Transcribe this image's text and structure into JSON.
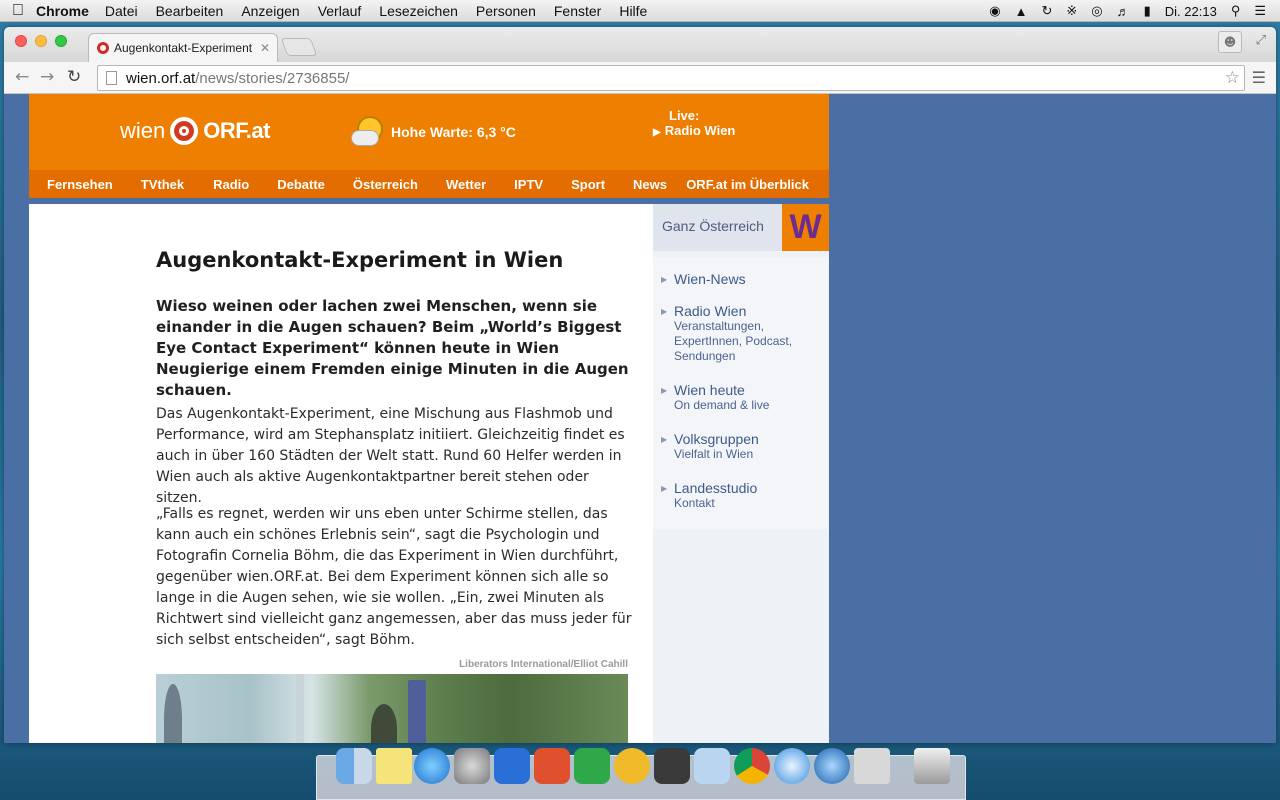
{
  "menubar": {
    "apple_icon": "apple-icon",
    "app_name": "Chrome",
    "items": [
      "Datei",
      "Bearbeiten",
      "Anzeigen",
      "Verlauf",
      "Lesezeichen",
      "Personen",
      "Fenster",
      "Hilfe"
    ],
    "clock": "Di. 22:13"
  },
  "browser": {
    "tab_title": "Augenkontakt-Experiment in Wien",
    "url_host": "wien.orf.at",
    "url_path": "/news/stories/2736855/"
  },
  "header": {
    "logo_left": "wien",
    "logo_right": "ORF.at",
    "weather": "Hohe Warte: 6,3 °C",
    "live_label": "Live:",
    "live_station": "Radio Wien"
  },
  "nav": {
    "items": [
      "Fernsehen",
      "TVthek",
      "Radio",
      "Debatte",
      "Österreich",
      "Wetter",
      "IPTV",
      "Sport",
      "News"
    ],
    "right": "ORF.at im Überblick"
  },
  "article": {
    "headline": "Augenkontakt-Experiment in Wien",
    "lead": "Wieso weinen oder lachen zwei Menschen, wenn sie einander in die Augen schauen? Beim „World’s Biggest Eye Contact Experiment“ können heute in Wien Neugierige einem Fremden einige Minuten in die Augen schauen.",
    "paragraph1": "Das Augenkontakt-Experiment, eine Mischung aus Flashmob und Performance, wird am Stephansplatz initiiert. Gleichzeitig findet es auch in über 160 Städten der Welt statt. Rund 60 Helfer werden in Wien auch als aktive Augenkontaktpartner bereit stehen oder sitzen.",
    "paragraph2": "„Falls es regnet, werden wir uns eben unter Schirme stellen, das kann auch ein schönes Erlebnis sein“, sagt die Psychologin und Fotografin Cornelia Böhm, die das Experiment in Wien durchführt, gegenüber wien.ORF.at. Bei dem Experiment können sich alle so lange in die Augen sehen, wie sie wollen. „Ein, zwei Minuten als Richtwert sind vielleicht ganz angemessen, aber das muss jeder für sich selbst entscheiden“, sagt Böhm.",
    "photo_credit": "Liberators International/Elliot Cahill"
  },
  "sidebar": {
    "region": "Ganz Österreich",
    "badge": "W",
    "items": [
      {
        "title": "Wien-News",
        "sub": ""
      },
      {
        "title": "Radio Wien",
        "sub": "Veranstaltungen, ExpertInnen, Podcast, Sendungen"
      },
      {
        "title": "Wien heute",
        "sub": "On demand & live"
      },
      {
        "title": "Volksgruppen",
        "sub": "Vielfalt in Wien"
      },
      {
        "title": "Landesstudio",
        "sub": "Kontakt"
      }
    ]
  },
  "colors": {
    "orf_orange": "#ee7f00",
    "nav_orange": "#e36d00",
    "page_background": "#4a6fa5",
    "sidebar_link": "#3d5a8a"
  },
  "dock": {
    "icons": [
      "finder-icon",
      "stickies-icon",
      "itunes-icon",
      "system-preferences-icon",
      "word-icon",
      "powerpoint-icon",
      "excel-icon",
      "outlook-icon",
      "photo-booth-icon",
      "preview-icon",
      "chrome-icon",
      "safari-icon",
      "quicktime-icon",
      "calculator-icon",
      "trash-icon"
    ]
  }
}
